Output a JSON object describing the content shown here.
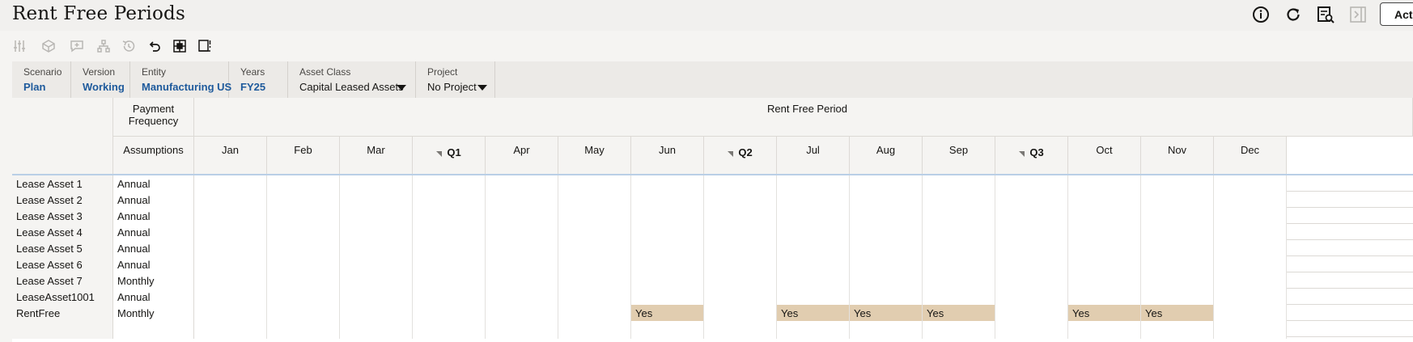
{
  "page": {
    "title": "Rent Free Periods"
  },
  "header_icons": [
    "info-icon",
    "refresh-icon",
    "report-search-icon",
    "collapse-panel-icon"
  ],
  "actions_label": "Acti",
  "toolbar_icons": [
    "adjust-icon",
    "cube-icon",
    "comment-icon",
    "hierarchy-icon",
    "history-icon",
    "undo-icon",
    "grid-cell-icon",
    "panel-edit-icon"
  ],
  "pov": [
    {
      "label": "Scenario",
      "value": "Plan"
    },
    {
      "label": "Version",
      "value": "Working"
    },
    {
      "label": "Entity",
      "value": "Manufacturing US"
    },
    {
      "label": "Years",
      "value": "FY25"
    },
    {
      "label": "Asset Class",
      "value": "Capital Leased Assets"
    },
    {
      "label": "Project",
      "value": "No Project"
    }
  ],
  "grid": {
    "payment_frequency_header": "Payment Frequency",
    "rent_free_header": "Rent Free Period",
    "assumptions_header": "Assumptions",
    "columns": [
      "Jan",
      "Feb",
      "Mar",
      "Q1",
      "Apr",
      "May",
      "Jun",
      "Q2",
      "Jul",
      "Aug",
      "Sep",
      "Q3",
      "Oct",
      "Nov",
      "Dec"
    ],
    "rows": [
      {
        "label": "Lease Asset 1",
        "assumption": "Annual",
        "cells": [
          "",
          "",
          "",
          "",
          "",
          "",
          "",
          "",
          "",
          "",
          "",
          "",
          "",
          "",
          ""
        ]
      },
      {
        "label": "Lease Asset 2",
        "assumption": "Annual",
        "cells": [
          "",
          "",
          "",
          "",
          "",
          "",
          "",
          "",
          "",
          "",
          "",
          "",
          "",
          "",
          ""
        ]
      },
      {
        "label": "Lease Asset 3",
        "assumption": "Annual",
        "cells": [
          "",
          "",
          "",
          "",
          "",
          "",
          "",
          "",
          "",
          "",
          "",
          "",
          "",
          "",
          ""
        ]
      },
      {
        "label": "Lease Asset 4",
        "assumption": "Annual",
        "cells": [
          "",
          "",
          "",
          "",
          "",
          "",
          "",
          "",
          "",
          "",
          "",
          "",
          "",
          "",
          ""
        ]
      },
      {
        "label": "Lease Asset 5",
        "assumption": "Annual",
        "cells": [
          "",
          "",
          "",
          "",
          "",
          "",
          "",
          "",
          "",
          "",
          "",
          "",
          "",
          "",
          ""
        ]
      },
      {
        "label": "Lease Asset 6",
        "assumption": "Annual",
        "cells": [
          "",
          "",
          "",
          "",
          "",
          "",
          "",
          "",
          "",
          "",
          "",
          "",
          "",
          "",
          ""
        ]
      },
      {
        "label": "Lease Asset 7",
        "assumption": "Monthly",
        "cells": [
          "",
          "",
          "",
          "",
          "",
          "",
          "",
          "",
          "",
          "",
          "",
          "",
          "",
          "",
          ""
        ]
      },
      {
        "label": "LeaseAsset1001",
        "assumption": "Annual",
        "cells": [
          "",
          "",
          "",
          "",
          "",
          "",
          "",
          "",
          "",
          "",
          "",
          "",
          "",
          "",
          ""
        ]
      },
      {
        "label": "RentFree",
        "assumption": "Monthly",
        "cells": [
          "",
          "",
          "",
          "",
          "",
          "",
          "Yes",
          "",
          "Yes",
          "Yes",
          "Yes",
          "",
          "Yes",
          "Yes",
          ""
        ]
      }
    ]
  },
  "colors": {
    "highlight": "#e1cdb0",
    "link": "#1e5a9c"
  }
}
